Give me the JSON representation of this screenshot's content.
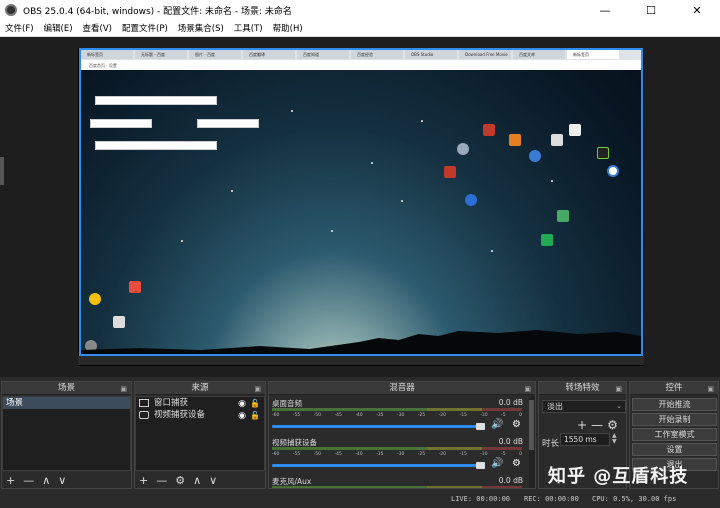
{
  "window": {
    "title": "OBS 25.0.4 (64-bit, windows) - 配置文件: 未命名 - 场景: 未命名",
    "minimize": "—",
    "maximize": "☐",
    "close": "✕"
  },
  "menu": [
    "文件(F)",
    "编辑(E)",
    "查看(V)",
    "配置文件(P)",
    "场景集合(S)",
    "工具(T)",
    "帮助(H)"
  ],
  "preview": {
    "browser_tabs": [
      "新标签页",
      "无标题 - 百度",
      "图片 - 百度",
      "百度翻译",
      "百度知道",
      "百度经验",
      "OBS Studio",
      "Download Free Movie",
      "百度文库",
      "新标签页"
    ],
    "url_text": "百度首页 · 设置"
  },
  "docks": {
    "scenes": {
      "title": "场景",
      "items": [
        "场景"
      ],
      "toolbar": [
        "+",
        "—",
        "∧",
        "∨"
      ]
    },
    "sources": {
      "title": "来源",
      "items": [
        {
          "label": "窗口捕获",
          "icon": "window-icon"
        },
        {
          "label": "视频捕获设备",
          "icon": "camera-icon"
        }
      ],
      "toolbar": [
        "+",
        "—",
        "⚙",
        "∧",
        "∨"
      ]
    },
    "mixer": {
      "title": "混音器",
      "ticks": [
        "-60",
        "-55",
        "-50",
        "-45",
        "-40",
        "-35",
        "-30",
        "-25",
        "-20",
        "-15",
        "-10",
        "-5",
        "0"
      ],
      "channels": [
        {
          "name": "桌面音频",
          "db": "0.0 dB",
          "volume": 1.0
        },
        {
          "name": "视频捕获设备",
          "db": "0.0 dB",
          "volume": 1.0
        },
        {
          "name": "麦克风/Aux",
          "db": "0.0 dB",
          "volume": 1.0
        }
      ]
    },
    "transitions": {
      "title": "转场特效",
      "selected": "淡出",
      "duration_label": "时长",
      "duration_value": "1550 ms",
      "add": "+",
      "remove": "—",
      "settings": "⚙"
    },
    "controls": {
      "title": "控件",
      "buttons": [
        "开始推流",
        "开始录制",
        "工作室模式",
        "设置",
        "退出"
      ]
    }
  },
  "status": {
    "live": "LIVE: 00:00:00",
    "rec": "REC: 00:00:00",
    "cpu": "CPU: 0.5%, 30.00 fps"
  },
  "watermark": "知乎 @互盾科技",
  "colors": {
    "accent": "#2d8cf0"
  }
}
